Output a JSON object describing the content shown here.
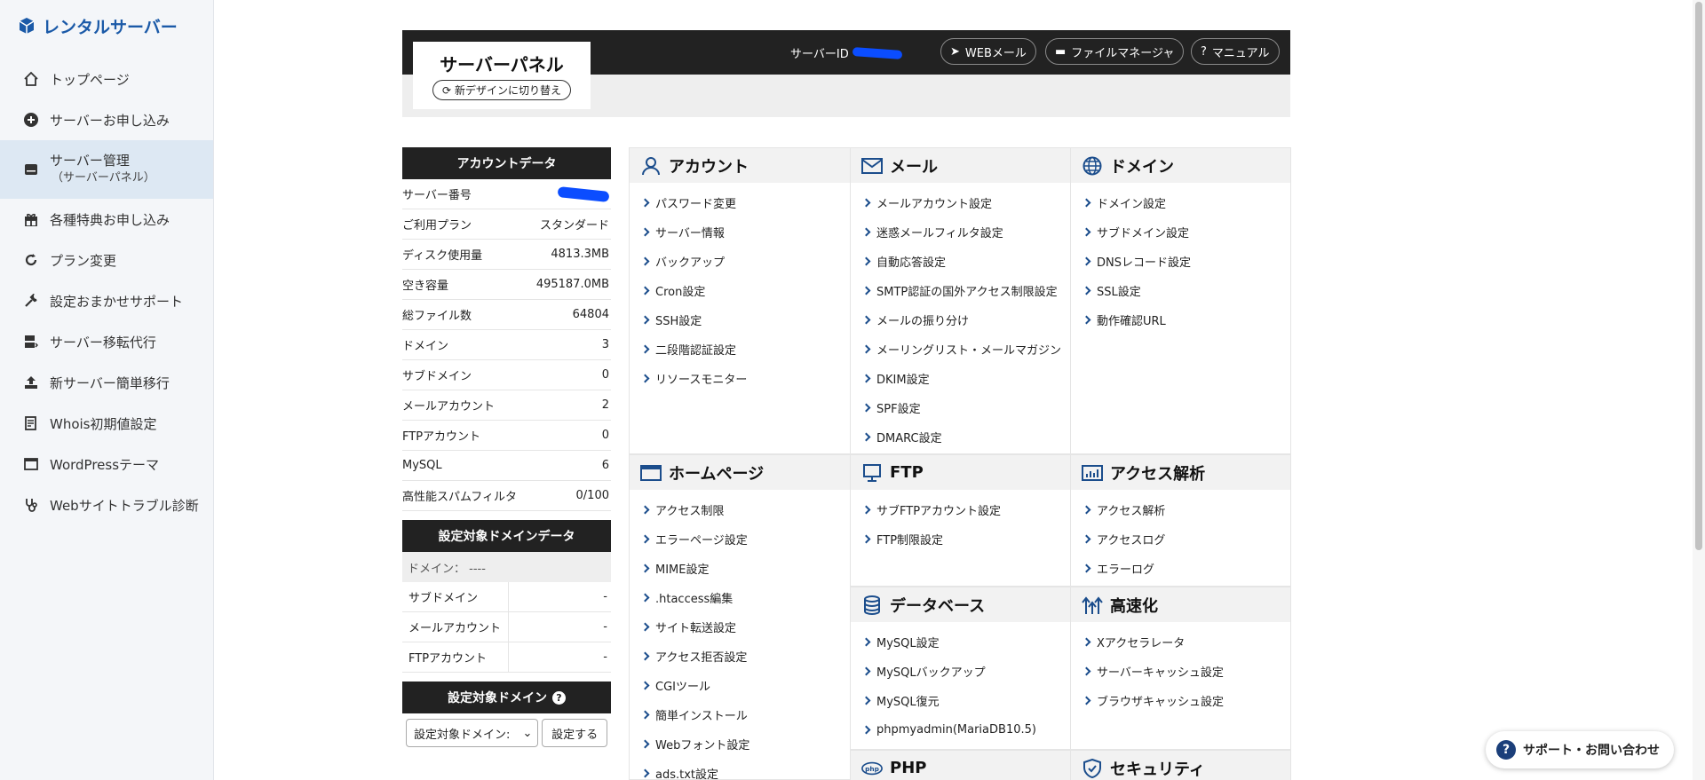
{
  "brand": {
    "name": "レンタルサーバー"
  },
  "sidebar": {
    "items": [
      {
        "label": "トップページ",
        "icon": "home-icon"
      },
      {
        "label": "サーバーお申し込み",
        "icon": "plus-circle-icon"
      },
      {
        "label": "サーバー管理",
        "sub": "（サーバーパネル）",
        "icon": "server-icon",
        "active": true
      },
      {
        "label": "各種特典お申し込み",
        "icon": "gift-icon"
      },
      {
        "label": "プラン変更",
        "icon": "refresh-icon"
      },
      {
        "label": "設定おまかせサポート",
        "icon": "wrench-icon"
      },
      {
        "label": "サーバー移転代行",
        "icon": "server-move-icon"
      },
      {
        "label": "新サーバー簡単移行",
        "icon": "upload-icon"
      },
      {
        "label": "Whois初期値設定",
        "icon": "document-icon"
      },
      {
        "label": "WordPressテーマ",
        "icon": "window-icon"
      },
      {
        "label": "Webサイトトラブル診断",
        "icon": "stethoscope-icon"
      }
    ]
  },
  "header": {
    "title": "サーバーパネル",
    "switch_label": "新デザインに切り替え",
    "server_id_label": "サーバーID",
    "buttons": {
      "webmail": "WEBメール",
      "file_manager": "ファイルマネージャ",
      "manual": "マニュアル"
    }
  },
  "account": {
    "heading": "アカウントデータ",
    "rows": [
      {
        "label": "サーバー番号",
        "value": ""
      },
      {
        "label": "ご利用プラン",
        "value": "スタンダード"
      },
      {
        "label": "ディスク使用量",
        "value": "4813.3MB"
      },
      {
        "label": "空き容量",
        "value": "495187.0MB"
      },
      {
        "label": "総ファイル数",
        "value": "64804"
      },
      {
        "label": "ドメイン",
        "value": "3"
      },
      {
        "label": "サブドメイン",
        "value": "0"
      },
      {
        "label": "メールアカウント",
        "value": "2"
      },
      {
        "label": "FTPアカウント",
        "value": "0"
      },
      {
        "label": "MySQL",
        "value": "6"
      },
      {
        "label": "高性能スパムフィルタ",
        "value": "0/100"
      }
    ]
  },
  "domain_data": {
    "heading": "設定対象ドメインデータ",
    "domain_line": "ドメイン： ----",
    "rows": [
      {
        "label": "サブドメイン",
        "value": "-"
      },
      {
        "label": "メールアカウント",
        "value": "-"
      },
      {
        "label": "FTPアカウント",
        "value": "-"
      }
    ]
  },
  "domain_select": {
    "heading": "設定対象ドメイン",
    "selected": "設定対象ドメイン:",
    "button": "設定する"
  },
  "menu": {
    "account": {
      "title": "アカウント",
      "links": [
        "パスワード変更",
        "サーバー情報",
        "バックアップ",
        "Cron設定",
        "SSH設定",
        "二段階認証設定",
        "リソースモニター"
      ]
    },
    "mail": {
      "title": "メール",
      "links": [
        "メールアカウント設定",
        "迷惑メールフィルタ設定",
        "自動応答設定",
        "SMTP認証の国外アクセス制限設定",
        "メールの振り分け",
        "メーリングリスト・メールマガジン",
        "DKIM設定",
        "SPF設定",
        "DMARC設定"
      ]
    },
    "domain": {
      "title": "ドメイン",
      "links": [
        "ドメイン設定",
        "サブドメイン設定",
        "DNSレコード設定",
        "SSL設定",
        "動作確認URL"
      ]
    },
    "homepage": {
      "title": "ホームページ",
      "links": [
        "アクセス制限",
        "エラーページ設定",
        "MIME設定",
        ".htaccess編集",
        "サイト転送設定",
        "アクセス拒否設定",
        "CGIツール",
        "簡単インストール",
        "Webフォント設定",
        "ads.txt設定"
      ]
    },
    "ftp": {
      "title": "FTP",
      "links": [
        "サブFTPアカウント設定",
        "FTP制限設定"
      ]
    },
    "analytics": {
      "title": "アクセス解析",
      "links": [
        "アクセス解析",
        "アクセスログ",
        "エラーログ"
      ]
    },
    "database": {
      "title": "データベース",
      "links": [
        "MySQL設定",
        "MySQLバックアップ",
        "MySQL復元",
        "phpmyadmin(MariaDB10.5)"
      ]
    },
    "speed": {
      "title": "高速化",
      "links": [
        "Xアクセラレータ",
        "サーバーキャッシュ設定",
        "ブラウザキャッシュ設定"
      ]
    },
    "php": {
      "title": "PHP"
    },
    "security": {
      "title": "セキュリティ"
    }
  },
  "support": {
    "label": "サポート・お問い合わせ"
  },
  "colors": {
    "accent": "#1b5aa8",
    "dark": "#222222",
    "mask": "#0b4dff"
  }
}
